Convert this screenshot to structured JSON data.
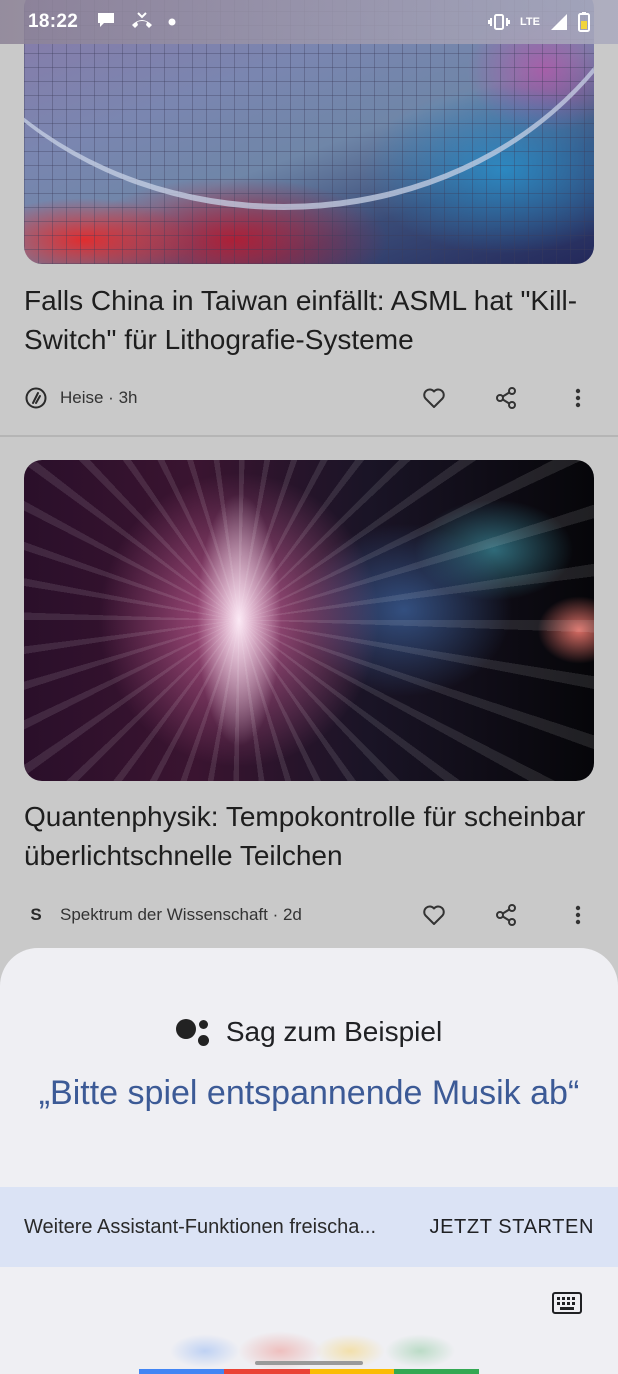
{
  "status_bar": {
    "time": "18:22",
    "left_icons": [
      "chat-bubble-icon",
      "missed-call-icon",
      "notification-dot-icon"
    ],
    "network_label": "LTE",
    "right_icons": [
      "vibrate-icon",
      "lte-icon",
      "signal-icon",
      "battery-icon"
    ]
  },
  "feed": {
    "articles": [
      {
        "title": "Falls China in Taiwan einfällt: ASML hat \"Kill-Switch\" für Lithografie-Systeme",
        "source_meta": "Heise · 3h",
        "logo": "heise-logo",
        "image": "chip-wafer-image"
      },
      {
        "title": "Quantenphysik: Tempokontrolle für scheinbar überlichtschnelle Teilchen",
        "source_meta": "Spektrum der Wissenschaft · 2d",
        "logo_letter": "S",
        "image": "quantum-particles-image"
      }
    ]
  },
  "assistant": {
    "header": "Sag zum Beispiel",
    "suggestion": "„Bitte spiel entspannende Musik ab“",
    "promo_text": "Weitere Assistant-Funktionen freischa...",
    "promo_button": "JETZT STARTEN",
    "accent_color": "#3c5a96",
    "bar_colors": [
      "#4285f4",
      "#ea4335",
      "#fbbc05",
      "#34a853"
    ]
  }
}
